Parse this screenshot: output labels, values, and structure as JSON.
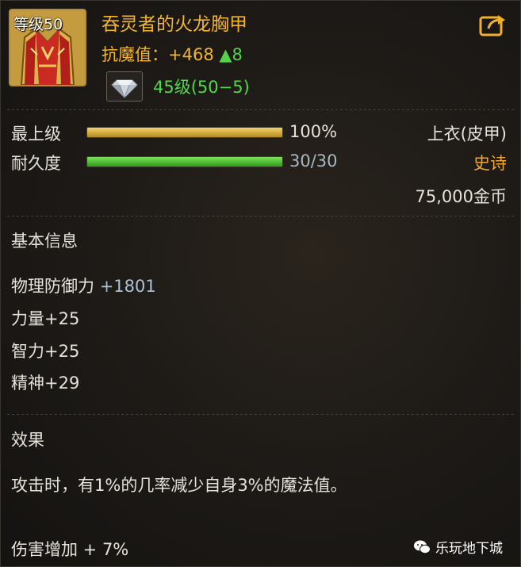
{
  "item": {
    "level_tag": "等级50",
    "name": "吞灵者的火龙胸甲",
    "stat_label": "抗魔值",
    "stat_value": "：+468 ",
    "stat_up": "▲8",
    "level_req": "45级(50−5)"
  },
  "bars": {
    "upgrade_label": "最上级",
    "upgrade_percent": "100%",
    "upgrade_fraction": 1.0,
    "durability_label": "耐久度",
    "durability_value": "30/30",
    "durability_fraction": 1.0
  },
  "meta": {
    "slot": "上衣(皮甲)",
    "rarity": "史诗",
    "price": "75,000金币"
  },
  "basic_info": {
    "title": "基本信息",
    "physical_def_label": "物理防御力 ",
    "physical_def_value": "+1801",
    "str": "力量+25",
    "int": "智力+25",
    "spi": "精神+29"
  },
  "effect": {
    "title": "效果",
    "desc": "攻击时，有1%的几率减少自身3%的魔法值。",
    "damage": "伤害增加 + 7%"
  },
  "watermark": {
    "text": "乐玩地下城"
  },
  "colors": {
    "gold_title": "#f3b52c",
    "green": "#53d64b",
    "epic": "#f0a62a"
  }
}
